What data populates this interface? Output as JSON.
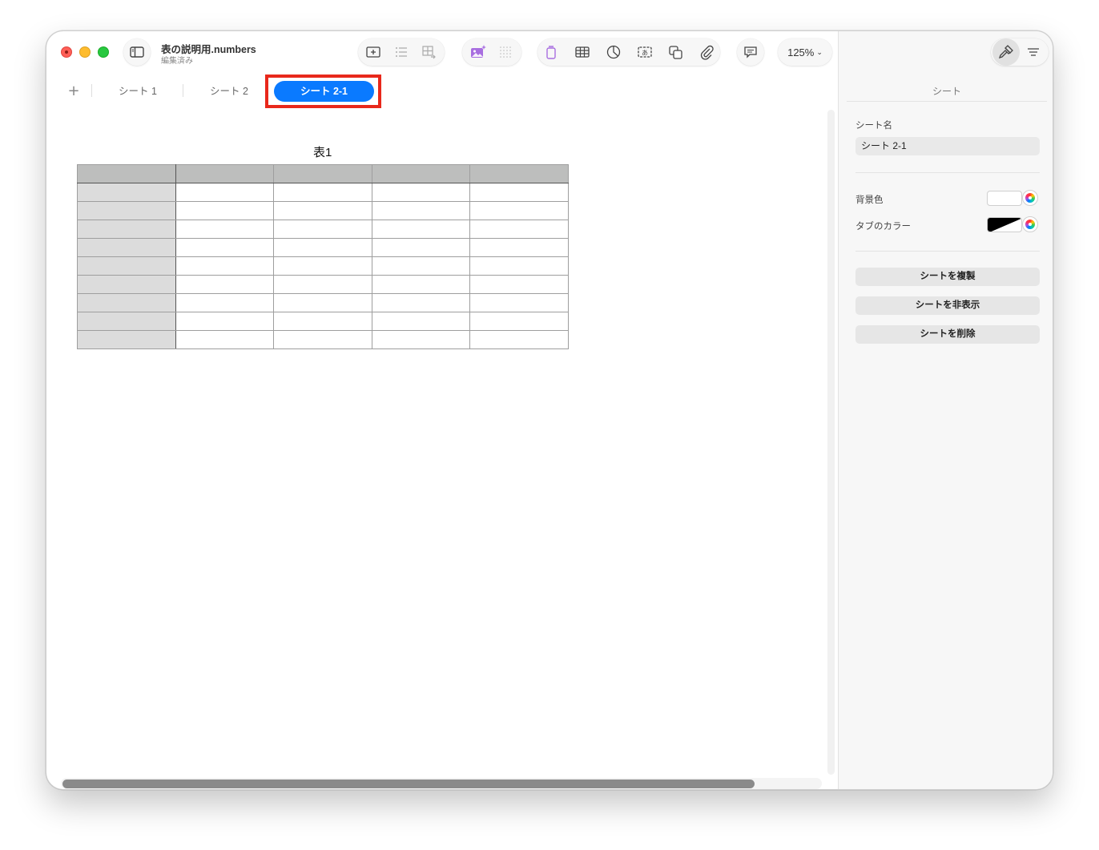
{
  "window": {
    "doc_title": "表の説明用.numbers",
    "doc_status": "編集済み"
  },
  "toolbar": {
    "zoom_label": "125%",
    "icons": [
      "sidebar-icon",
      "insert-text-box-icon",
      "list-icon",
      "table-add-icon",
      "image-playground-icon",
      "grid-icon",
      "clipboard-icon",
      "table-icon",
      "chart-icon",
      "text-icon",
      "shape-icon",
      "attachment-icon",
      "comment-icon",
      "share-icon",
      "format-brush-icon",
      "organize-icon"
    ]
  },
  "tabs": [
    {
      "label": "シート 1",
      "active": false
    },
    {
      "label": "シート 2",
      "active": false
    },
    {
      "label": "シート 2-1",
      "active": true
    }
  ],
  "canvas": {
    "table_title": "表1",
    "table": {
      "header_rows": 1,
      "header_columns": 1,
      "rows": 10,
      "columns": 5
    }
  },
  "inspector": {
    "title": "シート",
    "sheet_name_label": "シート名",
    "sheet_name_value": "シート 2-1",
    "background_label": "背景色",
    "background_color": "#ffffff",
    "tab_color_label": "タブのカラー",
    "buttons": {
      "duplicate": "シートを複製",
      "hide": "シートを非表示",
      "delete": "シートを削除"
    }
  },
  "colors": {
    "accent": "#0a7aff",
    "highlight": "#e8281b",
    "header_fill": "#bdbebd",
    "row_header_fill": "#dcdcdc"
  }
}
